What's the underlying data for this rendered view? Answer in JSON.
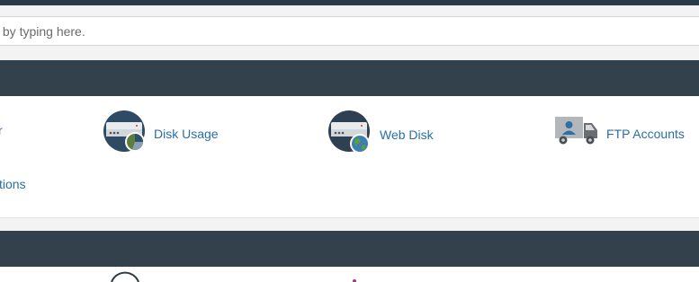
{
  "search": {
    "placeholder": "y by typing here."
  },
  "files_section": {
    "items": [
      {
        "label": "r",
        "icon": "cut-off-icon"
      },
      {
        "label": "Disk Usage",
        "icon": "disk-usage-icon"
      },
      {
        "label": "Web Disk",
        "icon": "web-disk-icon"
      },
      {
        "label": "FTP Accounts",
        "icon": "ftp-truck-icon"
      },
      {
        "label": "tions",
        "icon": ""
      }
    ]
  },
  "colors": {
    "header_bg": "#33414d",
    "link": "#2a6fa3",
    "top_bar": "#293a4a"
  }
}
